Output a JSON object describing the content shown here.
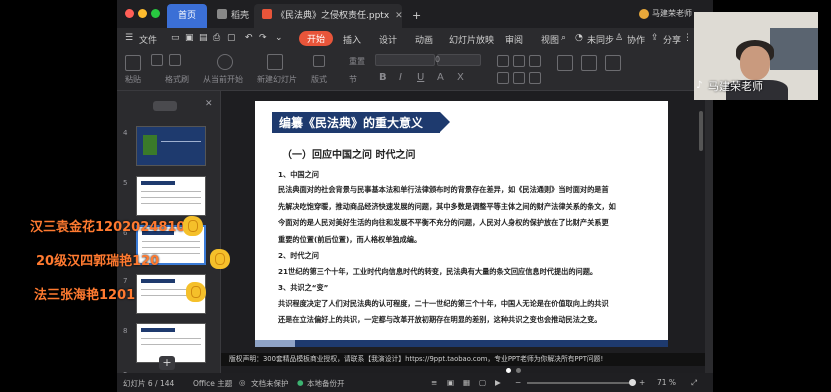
{
  "tabs": [
    {
      "label": "首页"
    },
    {
      "label": "稻壳"
    },
    {
      "label": "《民法典》之侵权责任.pptx"
    },
    {
      "label": "+"
    }
  ],
  "account": "马建荣老师",
  "menu": {
    "file": "文件",
    "start": "开始",
    "insert": "插入",
    "design": "设计",
    "animation": "动画",
    "slideshow": "幻灯片放映",
    "review": "审阅",
    "view": "视图",
    "sync": "未同步",
    "collab": "协作",
    "share": "分享"
  },
  "ribbon": {
    "paste": "粘贴",
    "format_painter": "格式刷",
    "play_from_current": "从当前开始",
    "new_slide": "新建幻灯片",
    "layout": "版式",
    "section": "节",
    "reset": "重置",
    "font_size": "0"
  },
  "thumbnails": [
    {
      "num": "4"
    },
    {
      "num": "5"
    },
    {
      "num": "6"
    },
    {
      "num": "7"
    },
    {
      "num": "8"
    },
    {
      "num": "9"
    }
  ],
  "slide": {
    "banner": "编纂《民法典》的重大意义",
    "subtitle": "（一）回应中国之问 时代之问",
    "paragraphs": [
      "1、中国之问",
      "民法典面对的社会背景与民事基本法和单行法律颁布时的背景存在差异，如《民法通则》当时面对的是首",
      "先解决吃饱穿暖，推动商品经济快速发展的问题，其中多数是调整平等主体之间的财产法律关系的条文，如",
      "今面对的是人民对美好生活的向往和发展不平衡不充分的问题，人民对人身权的保护放在了比财产关系更",
      "重要的位置(前后位置)，而人格权单独成编。",
      "2、时代之问",
      "21世纪的第三个十年，工业时代向信息时代的转变，民法典有大量的条文回应信息时代提出的问题。",
      "3、共识之“变”",
      "共识程度决定了人们对民法典的认可程度，二十一世纪的第三个十年，中国人无论是在价值取向上的共识",
      "还是在立法偏好上的共识，一定都与改革开放初期存在明显的差别，这种共识之变也会推动民法之变。"
    ]
  },
  "copyright": "版权声明：300套精品模板商业授权，请联系【我演设计】https://9ppt.taobao.com，专业PPT老师为你解决所有PPT问题!",
  "status": {
    "slide_info": "幻灯片 6 / 144",
    "theme": "Office 主题",
    "doc_protect": "文档未保护",
    "backup": "本地备份开",
    "zoom": "71 %"
  },
  "webcam_label": "马建荣老师",
  "danmu": [
    "汉三袁金花12020248106:",
    "20级汉四郭瑞艳120",
    "法三张海艳1201"
  ],
  "colors": {
    "accent": "#e8553a",
    "home_tab": "#3b6fd6",
    "banner": "#1e3a6e",
    "danmu": "#ff7a30"
  }
}
